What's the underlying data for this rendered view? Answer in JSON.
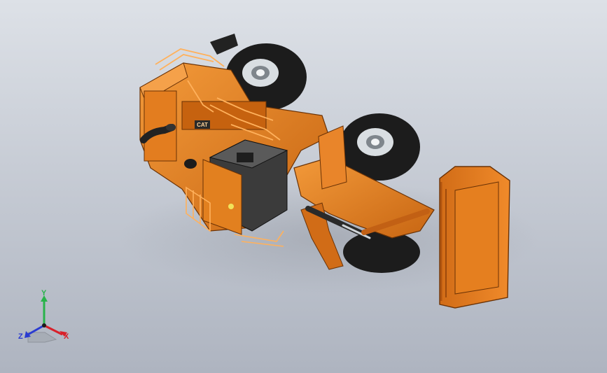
{
  "viewport": {
    "background_top": "#dde1e7",
    "background_bottom": "#aeb4c0"
  },
  "model": {
    "body_color": "#e07a1f",
    "body_shadow": "#a9520f",
    "tire_color": "#1c1c1c",
    "hub_color": "#e8ecef",
    "guard_color": "#ffb15c",
    "battery_color": "#3b3b3b",
    "brand_badge": "CAT"
  },
  "triad": {
    "x_label": "X",
    "y_label": "Y",
    "z_label": "Z",
    "x_color": "#d8202a",
    "y_color": "#29b34a",
    "z_color": "#2a3bd1"
  }
}
